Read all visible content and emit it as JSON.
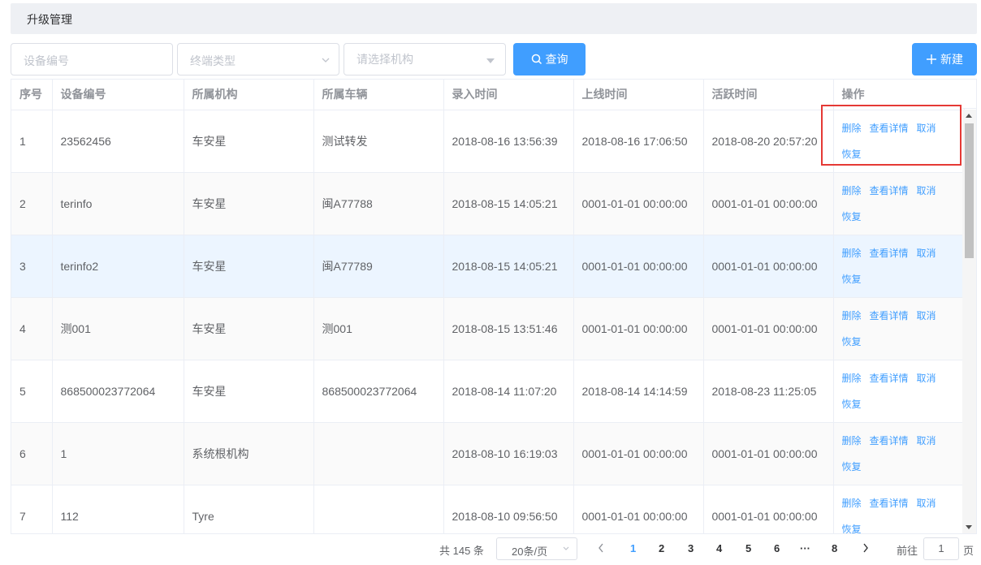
{
  "header": {
    "title": "升级管理"
  },
  "filters": {
    "device_no_placeholder": "设备编号",
    "terminal_type_placeholder": "终端类型",
    "org_placeholder": "请选择机构",
    "search_label": "查询",
    "new_label": "新建"
  },
  "table": {
    "columns": [
      "序号",
      "设备编号",
      "所属机构",
      "所属车辆",
      "录入时间",
      "上线时间",
      "活跃时间",
      "操作"
    ],
    "rows": [
      [
        "1",
        "23562456",
        "车安星",
        "测试转发",
        "2018-08-16 13:56:39",
        "2018-08-16 17:06:50",
        "2018-08-20 20:57:20"
      ],
      [
        "2",
        "terinfo",
        "车安星",
        "闽A77788",
        "2018-08-15 14:05:21",
        "0001-01-01 00:00:00",
        "0001-01-01 00:00:00"
      ],
      [
        "3",
        "terinfo2",
        "车安星",
        "闽A77789",
        "2018-08-15 14:05:21",
        "0001-01-01 00:00:00",
        "0001-01-01 00:00:00"
      ],
      [
        "4",
        "测001",
        "车安星",
        "测001",
        "2018-08-15 13:51:46",
        "0001-01-01 00:00:00",
        "0001-01-01 00:00:00"
      ],
      [
        "5",
        "868500023772064",
        "车安星",
        "868500023772064",
        "2018-08-14 11:07:20",
        "2018-08-14 14:14:59",
        "2018-08-23 11:25:05"
      ],
      [
        "6",
        "1",
        "系统根机构",
        "",
        "2018-08-10 16:19:03",
        "0001-01-01 00:00:00",
        "0001-01-01 00:00:00"
      ],
      [
        "7",
        "112",
        "Tyre",
        "",
        "2018-08-10 09:56:50",
        "0001-01-01 00:00:00",
        "0001-01-01 00:00:00"
      ]
    ],
    "actions": {
      "delete": "删除",
      "details": "查看详情",
      "cancel": "取消",
      "restore": "恢复"
    }
  },
  "pagination": {
    "total": "共 145 条",
    "page_size": "20条/页",
    "pages": [
      "1",
      "2",
      "3",
      "4",
      "5",
      "6",
      "···",
      "8"
    ],
    "current_page": "1",
    "goto_label": "前往",
    "goto_value": "1",
    "goto_unit": "页"
  },
  "colors": {
    "primary": "#409eff",
    "highlight_box": "#e53935"
  }
}
